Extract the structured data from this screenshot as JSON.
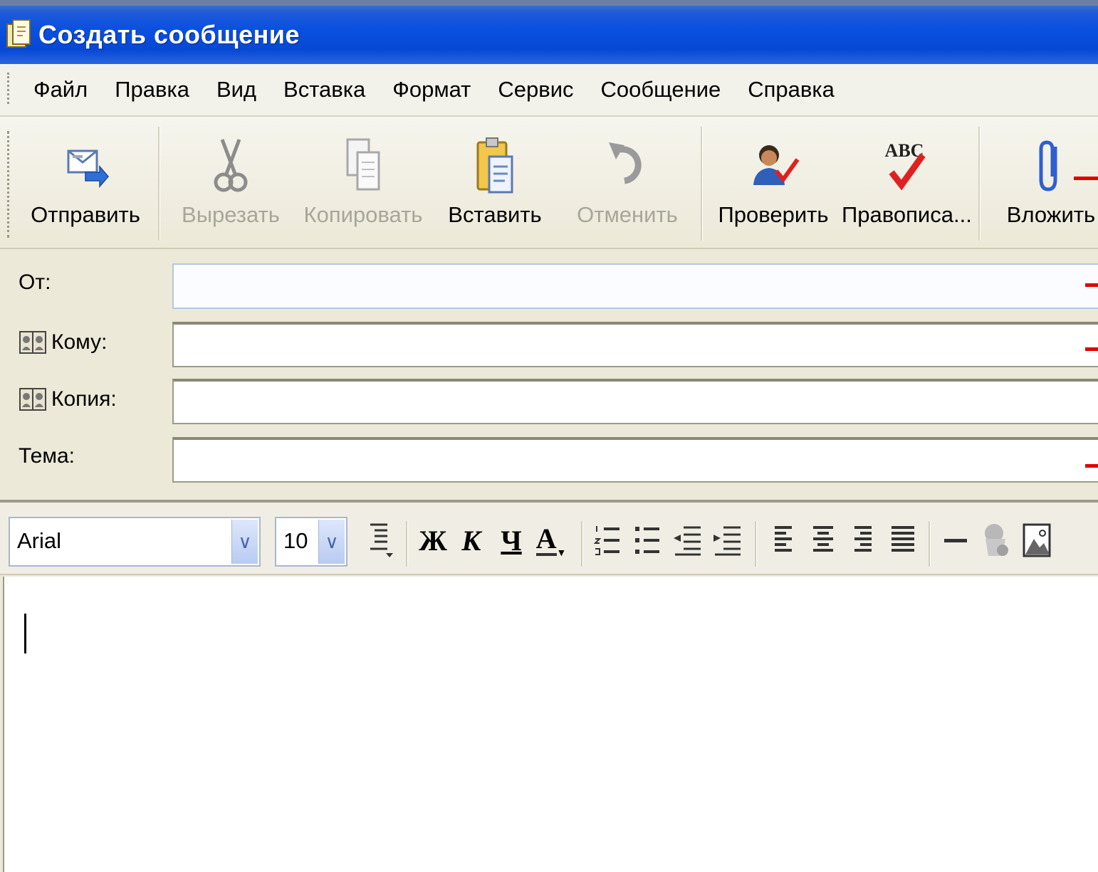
{
  "window": {
    "title": "Создать сообщение"
  },
  "menu": {
    "items": [
      "Файл",
      "Правка",
      "Вид",
      "Вставка",
      "Формат",
      "Сервис",
      "Сообщение",
      "Справка"
    ]
  },
  "toolbar": {
    "send": "Отправить",
    "cut": "Вырезать",
    "copy": "Копировать",
    "paste": "Вставить",
    "undo": "Отменить",
    "check": "Проверить",
    "spelling": "Правописа...",
    "attach": "Вложить"
  },
  "fields": {
    "from_label": "От:",
    "to_label": "Кому:",
    "cc_label": "Копия:",
    "subject_label": "Тема:",
    "from_value": "",
    "to_value": "",
    "cc_value": "",
    "subject_value": ""
  },
  "format": {
    "font": "Arial",
    "size": "10",
    "bold": "Ж",
    "italic": "К",
    "underline": "Ч",
    "font_color": "A"
  },
  "icons": {
    "send": "send-mail-icon",
    "cut": "scissors-icon",
    "copy": "copy-icon",
    "paste": "clipboard-icon",
    "undo": "undo-icon",
    "check": "check-names-icon",
    "spelling": "spelling-abc-icon",
    "attach": "paperclip-icon"
  },
  "colors": {
    "titlebar": "#0a50e0",
    "window_bg": "#ece9d8",
    "red_mark": "#e00000"
  }
}
